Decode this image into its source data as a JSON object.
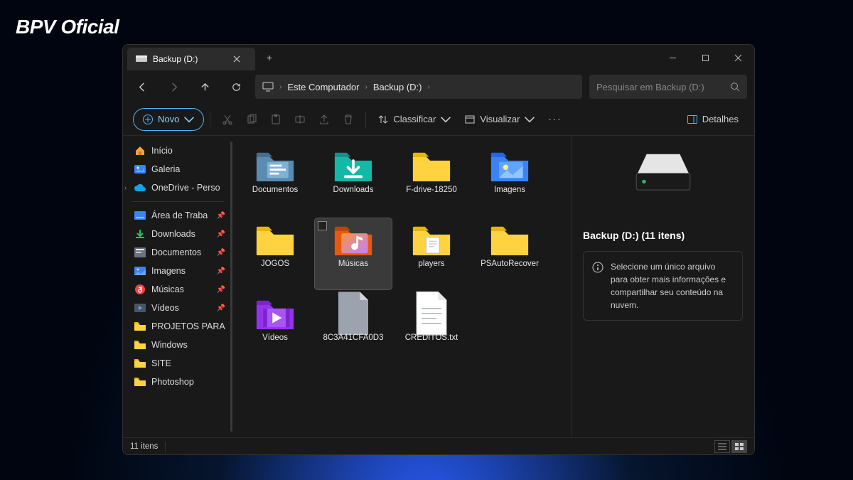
{
  "watermark": "BPV Oficial",
  "tab": {
    "title": "Backup (D:)"
  },
  "breadcrumb": {
    "root": "Este Computador",
    "current": "Backup (D:)"
  },
  "search": {
    "placeholder": "Pesquisar em Backup (D:)"
  },
  "toolbar": {
    "new": "Novo",
    "sort": "Classificar",
    "view": "Visualizar",
    "details": "Detalhes"
  },
  "sidebar": {
    "home": "Início",
    "gallery": "Galeria",
    "onedrive": "OneDrive - Perso",
    "items": [
      "Área de Traba",
      "Downloads",
      "Documentos",
      "Imagens",
      "Músicas",
      "Vídeos",
      "PROJETOS PARA",
      "Windows",
      "SITE",
      "Photoshop"
    ]
  },
  "grid": {
    "items": [
      {
        "name": "Documentos",
        "icon": "docs"
      },
      {
        "name": "Downloads",
        "icon": "downloads"
      },
      {
        "name": "F-drive-18250",
        "icon": "folder"
      },
      {
        "name": "Imagens",
        "icon": "images"
      },
      {
        "name": "JOGOS",
        "icon": "folder"
      },
      {
        "name": "Músicas",
        "icon": "music",
        "selected": true
      },
      {
        "name": "players",
        "icon": "folder-doc"
      },
      {
        "name": "PSAutoRecover",
        "icon": "folder"
      },
      {
        "name": "Vídeos",
        "icon": "videos"
      },
      {
        "name": "8C3A41CFA0D3",
        "icon": "file"
      },
      {
        "name": "CREDITOS.txt",
        "icon": "txt"
      }
    ]
  },
  "details": {
    "title": "Backup (D:) (11 itens)",
    "info": "Selecione um único arquivo para obter mais informações e compartilhar seu conteúdo na nuvem."
  },
  "status": {
    "count": "11 itens"
  }
}
